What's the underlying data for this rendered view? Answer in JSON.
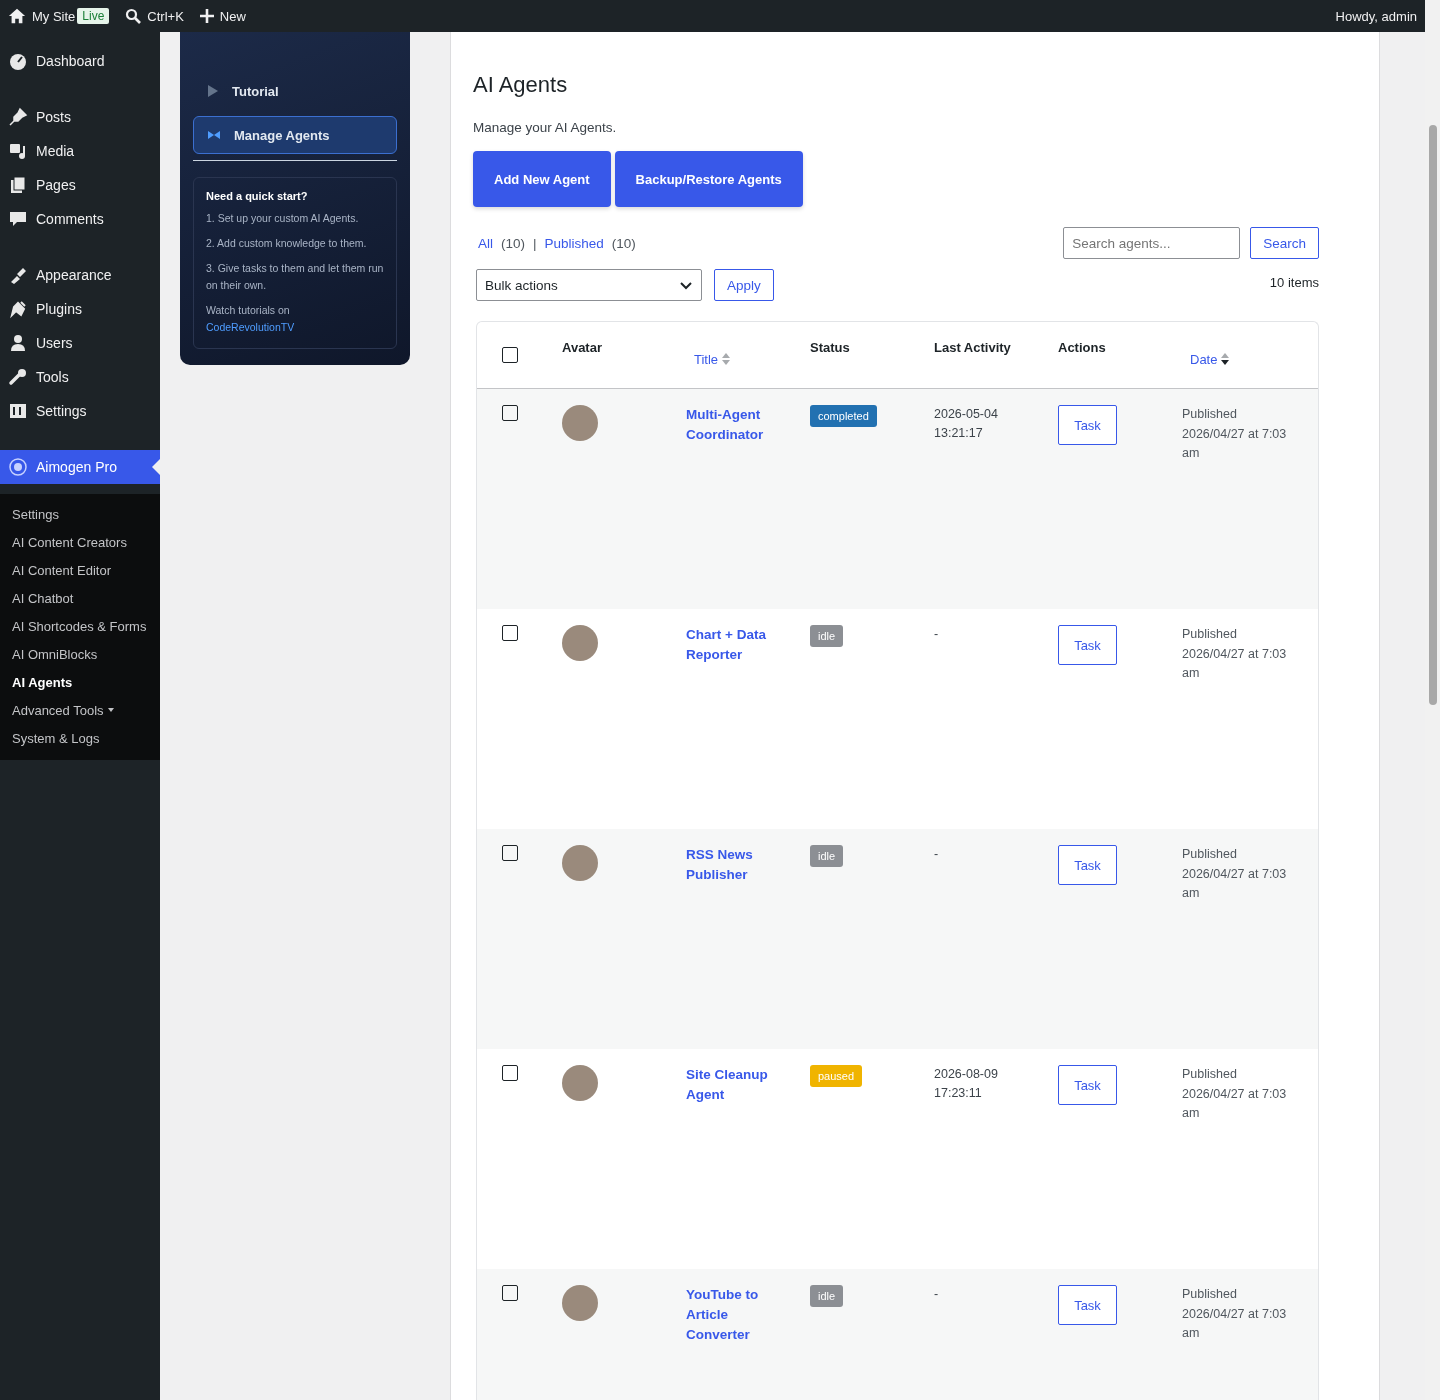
{
  "admin_bar": {
    "site": "My Site",
    "live_badge": "Live",
    "shortcut": "Ctrl+K",
    "new": "New",
    "greeting": "Howdy, admin"
  },
  "sidebar": {
    "groups": [
      [
        {
          "label": "Dashboard",
          "selected": false
        }
      ],
      [
        {
          "label": "Posts",
          "selected": false
        },
        {
          "label": "Media",
          "selected": false
        },
        {
          "label": "Pages",
          "selected": false
        },
        {
          "label": "Comments",
          "selected": false
        }
      ],
      [
        {
          "label": "Appearance",
          "selected": false
        },
        {
          "label": "Plugins",
          "selected": false
        },
        {
          "label": "Users",
          "selected": false
        },
        {
          "label": "Tools",
          "selected": false
        },
        {
          "label": "Settings",
          "selected": false
        }
      ],
      [
        {
          "label": "Aimogen Pro",
          "selected": true
        }
      ]
    ],
    "submenu": [
      {
        "label": "Settings",
        "selected": false,
        "expandable": false
      },
      {
        "label": "AI Content Creators",
        "selected": false,
        "expandable": false
      },
      {
        "label": "AI Content Editor",
        "selected": false,
        "expandable": false
      },
      {
        "label": "AI Chatbot",
        "selected": false,
        "expandable": false
      },
      {
        "label": "AI Shortcodes & Forms",
        "selected": false,
        "expandable": false
      },
      {
        "label": "AI OmniBlocks",
        "selected": false,
        "expandable": false
      },
      {
        "label": "AI Agents",
        "selected": true,
        "expandable": false
      },
      {
        "label": "Advanced Tools",
        "selected": false,
        "expandable": true
      },
      {
        "label": "System & Logs",
        "selected": false,
        "expandable": false
      }
    ]
  },
  "plugin_nav": {
    "items": [
      {
        "label": "Tutorial",
        "selected": false
      },
      {
        "label": "Manage Agents",
        "selected": true
      }
    ],
    "quick_start": {
      "title": "Need a quick start?",
      "steps": [
        "1. Set up your custom AI Agents.",
        "2. Add custom knowledge to them.",
        "3. Give tasks to them and let them run on their own."
      ],
      "watch_text": "Watch tutorials on",
      "link": "CodeRevolutionTV"
    }
  },
  "page": {
    "title": "AI Agents",
    "description": "Manage your AI Agents.",
    "buttons": [
      "Add New Agent",
      "Backup/Restore Agents"
    ],
    "filter_separator": "|",
    "filters": [
      {
        "label": "All",
        "count": "(10)"
      },
      {
        "label": "Published",
        "count": "(10)"
      }
    ],
    "search": {
      "placeholder": "Search agents...",
      "button": "Search"
    },
    "bulk_actions": {
      "value": "Bulk actions",
      "apply": "Apply"
    },
    "item_count": "10 items"
  },
  "table": {
    "select_all": {
      "checked": false
    },
    "columns": [
      {
        "label": "Avatar",
        "sortable": false
      },
      {
        "label": "Title",
        "sortable": true,
        "sorted": false
      },
      {
        "label": "Status",
        "sortable": false
      },
      {
        "label": "Last Activity",
        "sortable": false
      },
      {
        "label": "Actions",
        "sortable": false
      },
      {
        "label": "Date",
        "sortable": true,
        "sorted": true
      }
    ],
    "rows": [
      {
        "checked": false,
        "title": "Multi-Agent Coordinator",
        "status": "completed",
        "color": "#2271b1",
        "last_activity": "2026-05-04 13:21:17",
        "action": "Task",
        "date_status": "Published",
        "date": "2026/04/27 at 7:03 am"
      },
      {
        "checked": false,
        "title": "Chart + Data Reporter",
        "status": "idle",
        "color": "#8c8f94",
        "last_activity": "-",
        "action": "Task",
        "date_status": "Published",
        "date": "2026/04/27 at 7:03 am"
      },
      {
        "checked": false,
        "title": "RSS News Publisher",
        "status": "idle",
        "color": "#8c8f94",
        "last_activity": "-",
        "action": "Task",
        "date_status": "Published",
        "date": "2026/04/27 at 7:03 am"
      },
      {
        "checked": false,
        "title": "Site Cleanup Agent",
        "status": "paused",
        "color": "#f0b400",
        "last_activity": "2026-08-09 17:23:11",
        "action": "Task",
        "date_status": "Published",
        "date": "2026/04/27 at 7:03 am"
      },
      {
        "checked": false,
        "title": "YouTube to Article Converter",
        "status": "idle",
        "color": "#8c8f94",
        "last_activity": "-",
        "action": "Task",
        "date_status": "Published",
        "date": "2026/04/27 at 7:03 am"
      }
    ]
  }
}
